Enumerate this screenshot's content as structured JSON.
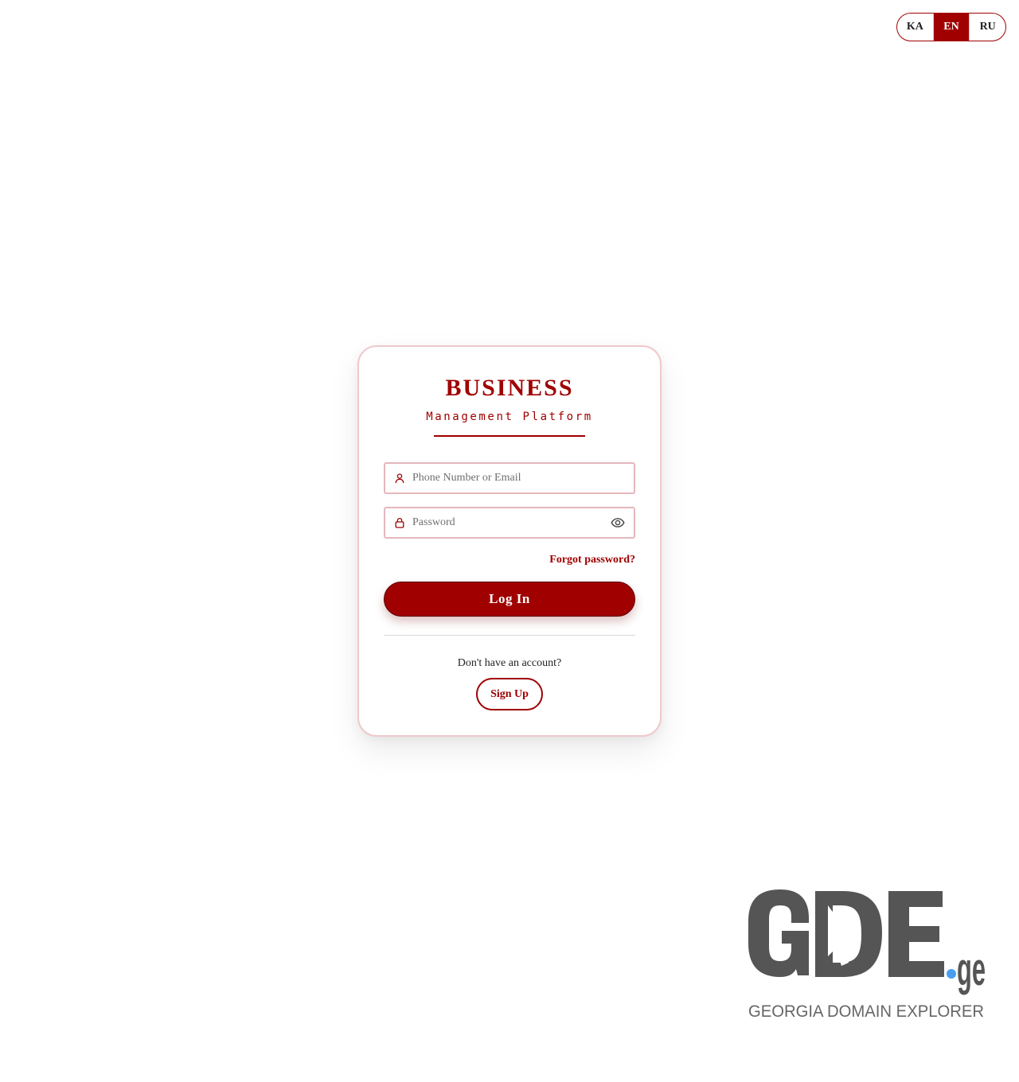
{
  "language_switcher": {
    "options": [
      {
        "code": "KA",
        "active": false
      },
      {
        "code": "EN",
        "active": true
      },
      {
        "code": "RU",
        "active": false
      }
    ]
  },
  "login_card": {
    "title": "BUSINESS",
    "subtitle": "Management Platform",
    "username_field": {
      "placeholder": "Phone Number or Email",
      "value": "",
      "icon": "user-icon"
    },
    "password_field": {
      "placeholder": "Password",
      "value": "",
      "icon": "lock-icon",
      "toggle_icon": "eye-icon"
    },
    "forgot_password_label": "Forgot password?",
    "login_button_label": "Log In",
    "no_account_text": "Don't have an account?",
    "signup_button_label": "Sign Up"
  },
  "watermark": {
    "logo_text": "GDE.ge",
    "tagline": "GEORGIA DOMAIN EXPLORER"
  },
  "colors": {
    "brand": "#a00000",
    "border_soft": "#efc9cc",
    "logo_gray": "#555555",
    "logo_dot": "#4a9ef0"
  }
}
